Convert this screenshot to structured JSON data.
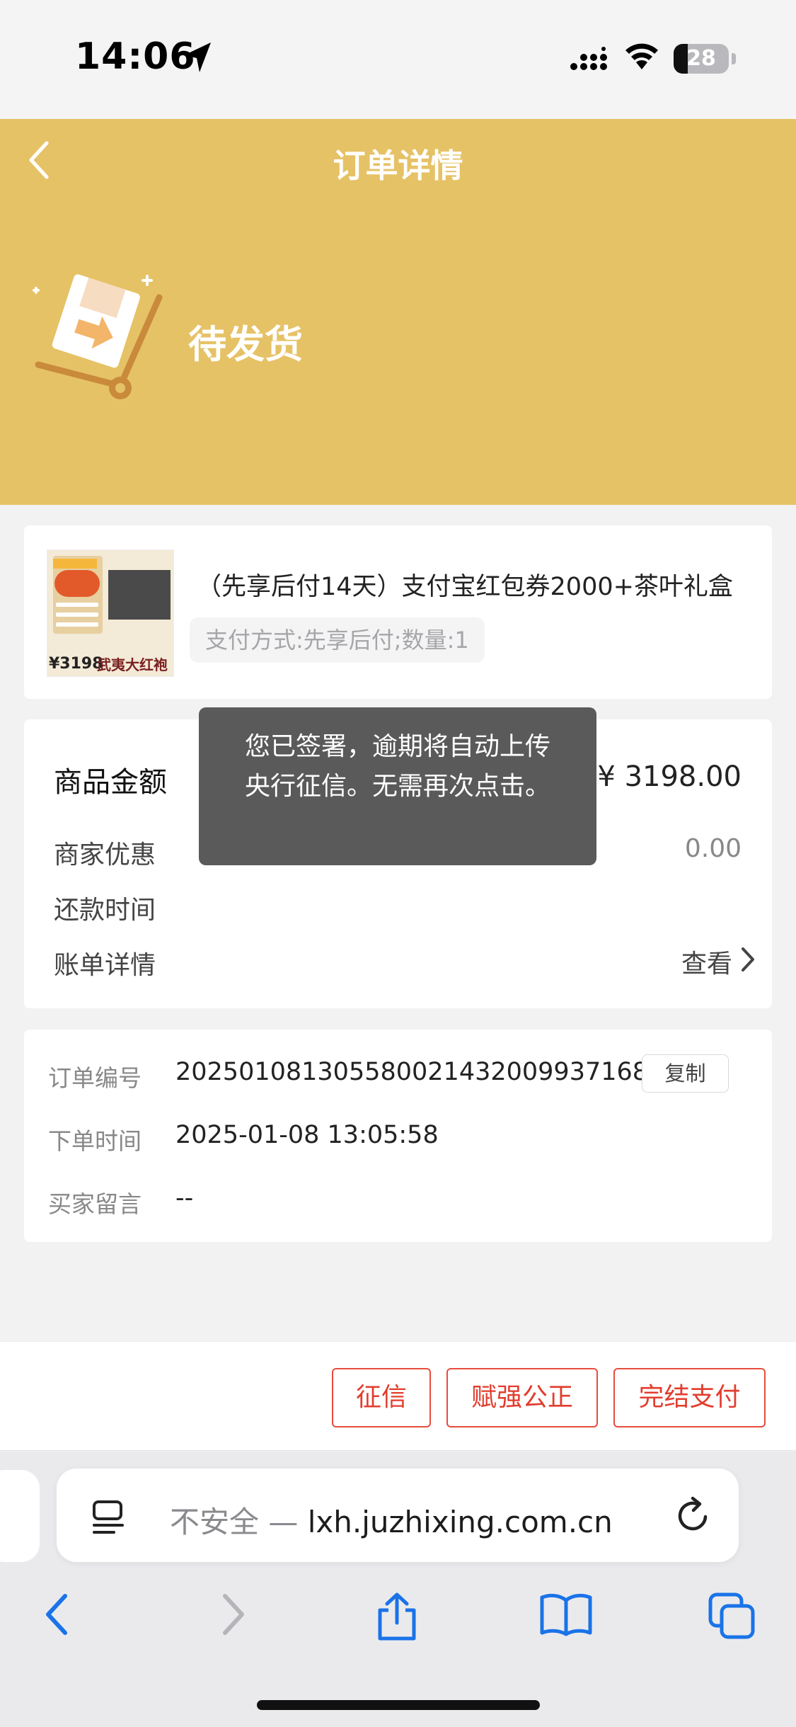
{
  "status_bar": {
    "time": "14:06",
    "battery": "28"
  },
  "header": {
    "title": "订单详情",
    "order_status": "待发货"
  },
  "product": {
    "title": "（先享后付14天）支付宝红包券2000+茶叶礼盒",
    "spec": "支付方式:先享后付;数量:1",
    "thumb_price": "¥3198",
    "thumb_brand": "武夷大红袍"
  },
  "amounts": {
    "goods_amount_label": "商品金额",
    "goods_amount_value": "¥ 3198.00",
    "merchant_discount_label": "商家优惠",
    "merchant_discount_value": "0.00",
    "repay_time_label": "还款时间",
    "bill_detail_label": "账单详情",
    "view_label": "查看"
  },
  "order_info": {
    "order_no_label": "订单编号",
    "order_no_value": "20250108130558002143200993716​8",
    "copy_label": "复制",
    "order_time_label": "下单时间",
    "order_time_value": "2025-01-08 13:05:58",
    "buyer_note_label": "买家留言",
    "buyer_note_value": "--"
  },
  "toast": {
    "message": "您已签署，逾期将自动上传央行征信。无需再次点击。"
  },
  "actions": {
    "credit_label": "征信",
    "notary_label": "赋强公正",
    "finish_pay_label": "完结支付"
  },
  "browser": {
    "insecure_label": "不安全 —",
    "domain": "lxh.juzhixing.com.cn"
  },
  "colors": {
    "header_bg": "#e6c266",
    "action_red": "#e23d2e",
    "ios_blue": "#1a73e8"
  }
}
